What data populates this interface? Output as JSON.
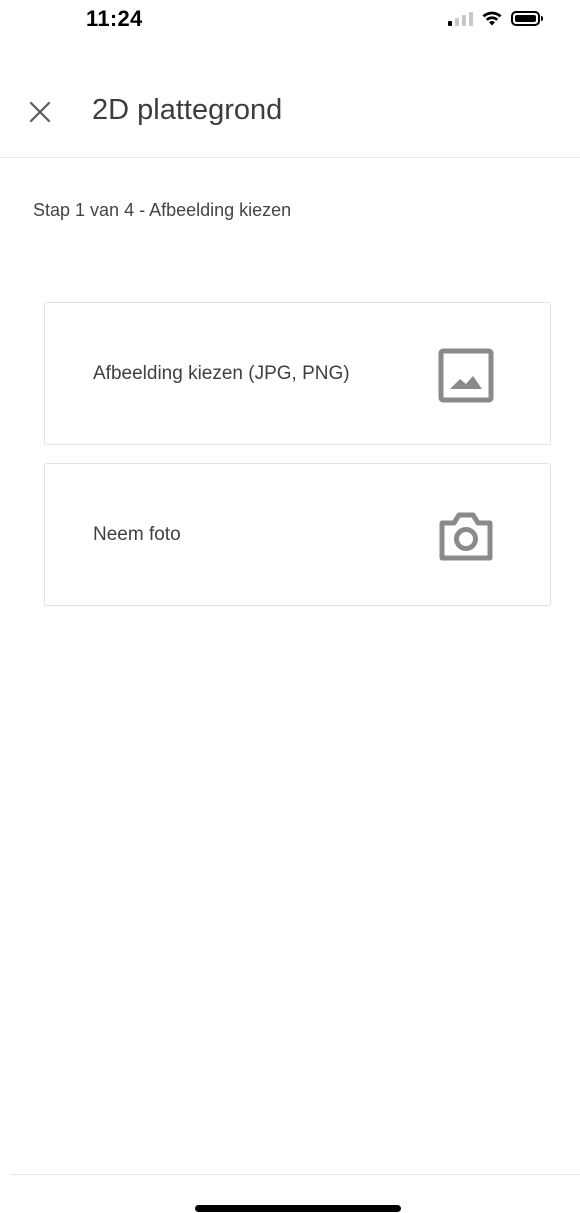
{
  "status_bar": {
    "time": "11:24"
  },
  "header": {
    "title": "2D plattegrond",
    "close_icon": "close-icon"
  },
  "step": {
    "label": "Stap 1 van 4 - Afbeelding kiezen"
  },
  "options": [
    {
      "label": "Afbeelding kiezen (JPG, PNG)",
      "icon": "image-icon"
    },
    {
      "label": "Neem foto",
      "icon": "camera-icon"
    }
  ],
  "colors": {
    "icon_gray": "#8a8a8a",
    "border": "#e2e2e2",
    "text": "#3f3f3f"
  }
}
